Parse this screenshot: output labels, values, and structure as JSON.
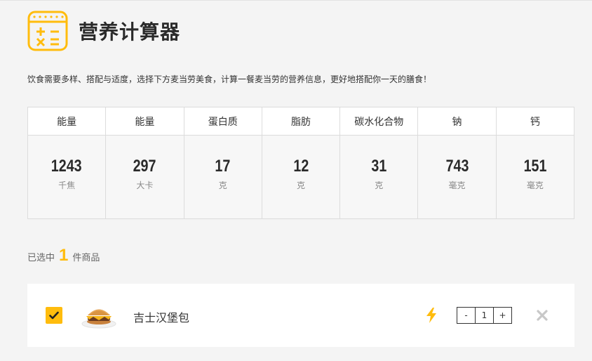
{
  "page": {
    "title": "营养计算器",
    "intro": "饮食需要多样、搭配与适度，选择下方麦当劳美食，计算一餐麦当劳的营养信息，更好地搭配你一天的膳食！"
  },
  "colors": {
    "accent": "#ffbc0d",
    "text": "#333333",
    "border": "#dcdcdc"
  },
  "nutrition": [
    {
      "label": "能量",
      "value": "1243",
      "unit": "千焦"
    },
    {
      "label": "能量",
      "value": "297",
      "unit": "大卡"
    },
    {
      "label": "蛋白质",
      "value": "17",
      "unit": "克"
    },
    {
      "label": "脂肪",
      "value": "12",
      "unit": "克"
    },
    {
      "label": "碳水化合物",
      "value": "31",
      "unit": "克"
    },
    {
      "label": "钠",
      "value": "743",
      "unit": "毫克"
    },
    {
      "label": "钙",
      "value": "151",
      "unit": "毫克"
    }
  ],
  "selection": {
    "prefix": "已选中",
    "count": "1",
    "suffix": "件商品"
  },
  "items": [
    {
      "name": "吉士汉堡包",
      "checked": true,
      "quantity": "1",
      "minus_label": "-",
      "plus_label": "+",
      "icons": {
        "image": "cheeseburger-image",
        "flag": "lightning-icon",
        "remove": "close-icon"
      }
    }
  ]
}
